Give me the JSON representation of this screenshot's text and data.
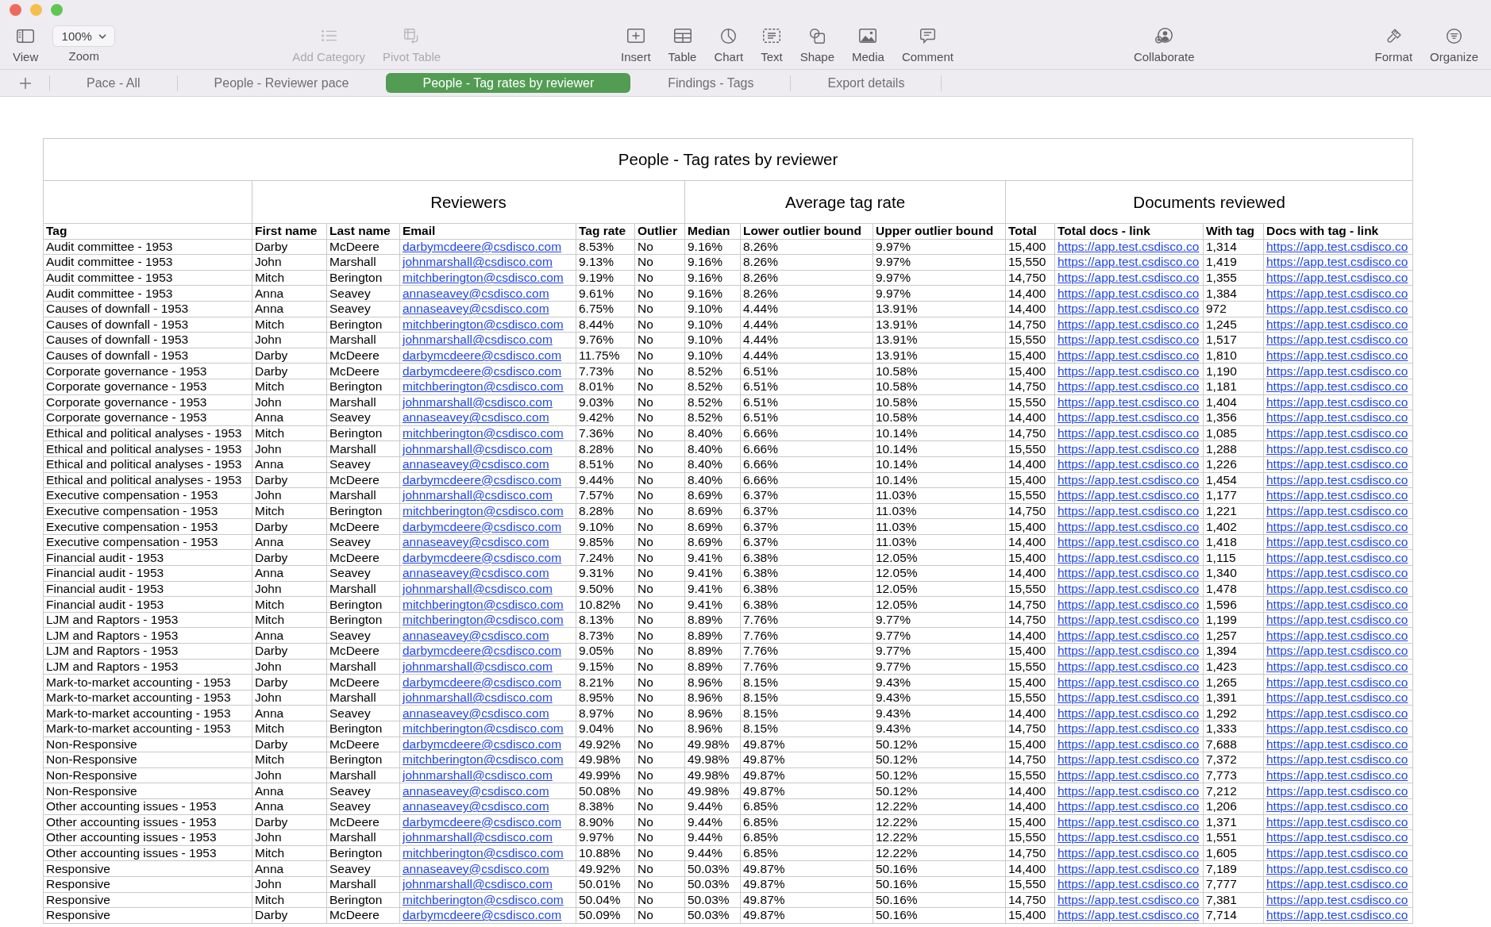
{
  "toolbar": {
    "groups": [
      [
        {
          "kind": "button",
          "label": "View",
          "disabled": false
        },
        {
          "kind": "dropdown",
          "label": "Zoom",
          "value": "100%",
          "disabled": false
        }
      ],
      [
        {
          "kind": "button",
          "label": "Add Category",
          "disabled": true
        },
        {
          "kind": "button",
          "label": "Pivot Table",
          "disabled": true
        }
      ],
      [
        {
          "kind": "button",
          "label": "Insert",
          "disabled": false
        },
        {
          "kind": "button",
          "label": "Table",
          "disabled": false
        },
        {
          "kind": "button",
          "label": "Chart",
          "disabled": false
        },
        {
          "kind": "button",
          "label": "Text",
          "disabled": false
        },
        {
          "kind": "button",
          "label": "Shape",
          "disabled": false
        },
        {
          "kind": "button",
          "label": "Media",
          "disabled": false
        },
        {
          "kind": "button",
          "label": "Comment",
          "disabled": false
        }
      ],
      [
        {
          "kind": "button",
          "label": "Collaborate",
          "disabled": false
        }
      ],
      [
        {
          "kind": "button",
          "label": "Format",
          "disabled": false
        },
        {
          "kind": "button",
          "label": "Organize",
          "disabled": false
        }
      ]
    ]
  },
  "sheet_tabs": [
    {
      "label": "Pace - All",
      "selected": false
    },
    {
      "label": "People - Reviewer pace",
      "selected": false
    },
    {
      "label": "People - Tag rates by reviewer",
      "selected": true
    },
    {
      "label": "Findings - Tags",
      "selected": false
    },
    {
      "label": "Export details",
      "selected": false
    }
  ],
  "table": {
    "title": "People - Tag rates by reviewer",
    "column_groups": [
      {
        "columns": [
          {
            "label": "Tag",
            "kind": "text"
          }
        ]
      },
      {
        "label": "Reviewers",
        "columns": [
          {
            "label": "First name",
            "kind": "text"
          },
          {
            "label": "Last name",
            "kind": "text"
          },
          {
            "label": "Email",
            "kind": "email"
          },
          {
            "label": "Tag rate",
            "kind": "text"
          },
          {
            "label": "Outlier",
            "kind": "text"
          }
        ]
      },
      {
        "label": "Average tag rate",
        "columns": [
          {
            "label": "Median",
            "kind": "text"
          },
          {
            "label": "Lower outlier bound",
            "kind": "text"
          },
          {
            "label": "Upper outlier bound",
            "kind": "text"
          }
        ]
      },
      {
        "label": "Documents reviewed",
        "columns": [
          {
            "label": "Total",
            "kind": "text"
          },
          {
            "label": "Total docs - link",
            "kind": "url"
          },
          {
            "label": "With tag",
            "kind": "text"
          },
          {
            "label": "Docs with tag - link",
            "kind": "url"
          }
        ]
      }
    ],
    "rows": [
      [
        "Audit committee - 1953",
        "Darby",
        "McDeere",
        "darbymcdeere@csdisco.com",
        "8.53%",
        "No",
        "9.16%",
        "8.26%",
        "9.97%",
        "15,400",
        "https://app.test.csdisco.co",
        "1,314",
        "https://app.test.csdisco.co"
      ],
      [
        "Audit committee - 1953",
        "John",
        "Marshall",
        "johnmarshall@csdisco.com",
        "9.13%",
        "No",
        "9.16%",
        "8.26%",
        "9.97%",
        "15,550",
        "https://app.test.csdisco.co",
        "1,419",
        "https://app.test.csdisco.co"
      ],
      [
        "Audit committee - 1953",
        "Mitch",
        "Berington",
        "mitchberington@csdisco.com",
        "9.19%",
        "No",
        "9.16%",
        "8.26%",
        "9.97%",
        "14,750",
        "https://app.test.csdisco.co",
        "1,355",
        "https://app.test.csdisco.co"
      ],
      [
        "Audit committee - 1953",
        "Anna",
        "Seavey",
        "annaseavey@csdisco.com",
        "9.61%",
        "No",
        "9.16%",
        "8.26%",
        "9.97%",
        "14,400",
        "https://app.test.csdisco.co",
        "1,384",
        "https://app.test.csdisco.co"
      ],
      [
        "Causes of downfall - 1953",
        "Anna",
        "Seavey",
        "annaseavey@csdisco.com",
        "6.75%",
        "No",
        "9.10%",
        "4.44%",
        "13.91%",
        "14,400",
        "https://app.test.csdisco.co",
        "972",
        "https://app.test.csdisco.co"
      ],
      [
        "Causes of downfall - 1953",
        "Mitch",
        "Berington",
        "mitchberington@csdisco.com",
        "8.44%",
        "No",
        "9.10%",
        "4.44%",
        "13.91%",
        "14,750",
        "https://app.test.csdisco.co",
        "1,245",
        "https://app.test.csdisco.co"
      ],
      [
        "Causes of downfall - 1953",
        "John",
        "Marshall",
        "johnmarshall@csdisco.com",
        "9.76%",
        "No",
        "9.10%",
        "4.44%",
        "13.91%",
        "15,550",
        "https://app.test.csdisco.co",
        "1,517",
        "https://app.test.csdisco.co"
      ],
      [
        "Causes of downfall - 1953",
        "Darby",
        "McDeere",
        "darbymcdeere@csdisco.com",
        "11.75%",
        "No",
        "9.10%",
        "4.44%",
        "13.91%",
        "15,400",
        "https://app.test.csdisco.co",
        "1,810",
        "https://app.test.csdisco.co"
      ],
      [
        "Corporate governance - 1953",
        "Darby",
        "McDeere",
        "darbymcdeere@csdisco.com",
        "7.73%",
        "No",
        "8.52%",
        "6.51%",
        "10.58%",
        "15,400",
        "https://app.test.csdisco.co",
        "1,190",
        "https://app.test.csdisco.co"
      ],
      [
        "Corporate governance - 1953",
        "Mitch",
        "Berington",
        "mitchberington@csdisco.com",
        "8.01%",
        "No",
        "8.52%",
        "6.51%",
        "10.58%",
        "14,750",
        "https://app.test.csdisco.co",
        "1,181",
        "https://app.test.csdisco.co"
      ],
      [
        "Corporate governance - 1953",
        "John",
        "Marshall",
        "johnmarshall@csdisco.com",
        "9.03%",
        "No",
        "8.52%",
        "6.51%",
        "10.58%",
        "15,550",
        "https://app.test.csdisco.co",
        "1,404",
        "https://app.test.csdisco.co"
      ],
      [
        "Corporate governance - 1953",
        "Anna",
        "Seavey",
        "annaseavey@csdisco.com",
        "9.42%",
        "No",
        "8.52%",
        "6.51%",
        "10.58%",
        "14,400",
        "https://app.test.csdisco.co",
        "1,356",
        "https://app.test.csdisco.co"
      ],
      [
        "Ethical and political analyses - 1953",
        "Mitch",
        "Berington",
        "mitchberington@csdisco.com",
        "7.36%",
        "No",
        "8.40%",
        "6.66%",
        "10.14%",
        "14,750",
        "https://app.test.csdisco.co",
        "1,085",
        "https://app.test.csdisco.co"
      ],
      [
        "Ethical and political analyses - 1953",
        "John",
        "Marshall",
        "johnmarshall@csdisco.com",
        "8.28%",
        "No",
        "8.40%",
        "6.66%",
        "10.14%",
        "15,550",
        "https://app.test.csdisco.co",
        "1,288",
        "https://app.test.csdisco.co"
      ],
      [
        "Ethical and political analyses - 1953",
        "Anna",
        "Seavey",
        "annaseavey@csdisco.com",
        "8.51%",
        "No",
        "8.40%",
        "6.66%",
        "10.14%",
        "14,400",
        "https://app.test.csdisco.co",
        "1,226",
        "https://app.test.csdisco.co"
      ],
      [
        "Ethical and political analyses - 1953",
        "Darby",
        "McDeere",
        "darbymcdeere@csdisco.com",
        "9.44%",
        "No",
        "8.40%",
        "6.66%",
        "10.14%",
        "15,400",
        "https://app.test.csdisco.co",
        "1,454",
        "https://app.test.csdisco.co"
      ],
      [
        "Executive compensation - 1953",
        "John",
        "Marshall",
        "johnmarshall@csdisco.com",
        "7.57%",
        "No",
        "8.69%",
        "6.37%",
        "11.03%",
        "15,550",
        "https://app.test.csdisco.co",
        "1,177",
        "https://app.test.csdisco.co"
      ],
      [
        "Executive compensation - 1953",
        "Mitch",
        "Berington",
        "mitchberington@csdisco.com",
        "8.28%",
        "No",
        "8.69%",
        "6.37%",
        "11.03%",
        "14,750",
        "https://app.test.csdisco.co",
        "1,221",
        "https://app.test.csdisco.co"
      ],
      [
        "Executive compensation - 1953",
        "Darby",
        "McDeere",
        "darbymcdeere@csdisco.com",
        "9.10%",
        "No",
        "8.69%",
        "6.37%",
        "11.03%",
        "15,400",
        "https://app.test.csdisco.co",
        "1,402",
        "https://app.test.csdisco.co"
      ],
      [
        "Executive compensation - 1953",
        "Anna",
        "Seavey",
        "annaseavey@csdisco.com",
        "9.85%",
        "No",
        "8.69%",
        "6.37%",
        "11.03%",
        "14,400",
        "https://app.test.csdisco.co",
        "1,418",
        "https://app.test.csdisco.co"
      ],
      [
        "Financial audit - 1953",
        "Darby",
        "McDeere",
        "darbymcdeere@csdisco.com",
        "7.24%",
        "No",
        "9.41%",
        "6.38%",
        "12.05%",
        "15,400",
        "https://app.test.csdisco.co",
        "1,115",
        "https://app.test.csdisco.co"
      ],
      [
        "Financial audit - 1953",
        "Anna",
        "Seavey",
        "annaseavey@csdisco.com",
        "9.31%",
        "No",
        "9.41%",
        "6.38%",
        "12.05%",
        "14,400",
        "https://app.test.csdisco.co",
        "1,340",
        "https://app.test.csdisco.co"
      ],
      [
        "Financial audit - 1953",
        "John",
        "Marshall",
        "johnmarshall@csdisco.com",
        "9.50%",
        "No",
        "9.41%",
        "6.38%",
        "12.05%",
        "15,550",
        "https://app.test.csdisco.co",
        "1,478",
        "https://app.test.csdisco.co"
      ],
      [
        "Financial audit - 1953",
        "Mitch",
        "Berington",
        "mitchberington@csdisco.com",
        "10.82%",
        "No",
        "9.41%",
        "6.38%",
        "12.05%",
        "14,750",
        "https://app.test.csdisco.co",
        "1,596",
        "https://app.test.csdisco.co"
      ],
      [
        "LJM and Raptors - 1953",
        "Mitch",
        "Berington",
        "mitchberington@csdisco.com",
        "8.13%",
        "No",
        "8.89%",
        "7.76%",
        "9.77%",
        "14,750",
        "https://app.test.csdisco.co",
        "1,199",
        "https://app.test.csdisco.co"
      ],
      [
        "LJM and Raptors - 1953",
        "Anna",
        "Seavey",
        "annaseavey@csdisco.com",
        "8.73%",
        "No",
        "8.89%",
        "7.76%",
        "9.77%",
        "14,400",
        "https://app.test.csdisco.co",
        "1,257",
        "https://app.test.csdisco.co"
      ],
      [
        "LJM and Raptors - 1953",
        "Darby",
        "McDeere",
        "darbymcdeere@csdisco.com",
        "9.05%",
        "No",
        "8.89%",
        "7.76%",
        "9.77%",
        "15,400",
        "https://app.test.csdisco.co",
        "1,394",
        "https://app.test.csdisco.co"
      ],
      [
        "LJM and Raptors - 1953",
        "John",
        "Marshall",
        "johnmarshall@csdisco.com",
        "9.15%",
        "No",
        "8.89%",
        "7.76%",
        "9.77%",
        "15,550",
        "https://app.test.csdisco.co",
        "1,423",
        "https://app.test.csdisco.co"
      ],
      [
        "Mark-to-market accounting - 1953",
        "Darby",
        "McDeere",
        "darbymcdeere@csdisco.com",
        "8.21%",
        "No",
        "8.96%",
        "8.15%",
        "9.43%",
        "15,400",
        "https://app.test.csdisco.co",
        "1,265",
        "https://app.test.csdisco.co"
      ],
      [
        "Mark-to-market accounting - 1953",
        "John",
        "Marshall",
        "johnmarshall@csdisco.com",
        "8.95%",
        "No",
        "8.96%",
        "8.15%",
        "9.43%",
        "15,550",
        "https://app.test.csdisco.co",
        "1,391",
        "https://app.test.csdisco.co"
      ],
      [
        "Mark-to-market accounting - 1953",
        "Anna",
        "Seavey",
        "annaseavey@csdisco.com",
        "8.97%",
        "No",
        "8.96%",
        "8.15%",
        "9.43%",
        "14,400",
        "https://app.test.csdisco.co",
        "1,292",
        "https://app.test.csdisco.co"
      ],
      [
        "Mark-to-market accounting - 1953",
        "Mitch",
        "Berington",
        "mitchberington@csdisco.com",
        "9.04%",
        "No",
        "8.96%",
        "8.15%",
        "9.43%",
        "14,750",
        "https://app.test.csdisco.co",
        "1,333",
        "https://app.test.csdisco.co"
      ],
      [
        "Non-Responsive",
        "Darby",
        "McDeere",
        "darbymcdeere@csdisco.com",
        "49.92%",
        "No",
        "49.98%",
        "49.87%",
        "50.12%",
        "15,400",
        "https://app.test.csdisco.co",
        "7,688",
        "https://app.test.csdisco.co"
      ],
      [
        "Non-Responsive",
        "Mitch",
        "Berington",
        "mitchberington@csdisco.com",
        "49.98%",
        "No",
        "49.98%",
        "49.87%",
        "50.12%",
        "14,750",
        "https://app.test.csdisco.co",
        "7,372",
        "https://app.test.csdisco.co"
      ],
      [
        "Non-Responsive",
        "John",
        "Marshall",
        "johnmarshall@csdisco.com",
        "49.99%",
        "No",
        "49.98%",
        "49.87%",
        "50.12%",
        "15,550",
        "https://app.test.csdisco.co",
        "7,773",
        "https://app.test.csdisco.co"
      ],
      [
        "Non-Responsive",
        "Anna",
        "Seavey",
        "annaseavey@csdisco.com",
        "50.08%",
        "No",
        "49.98%",
        "49.87%",
        "50.12%",
        "14,400",
        "https://app.test.csdisco.co",
        "7,212",
        "https://app.test.csdisco.co"
      ],
      [
        "Other accounting issues - 1953",
        "Anna",
        "Seavey",
        "annaseavey@csdisco.com",
        "8.38%",
        "No",
        "9.44%",
        "6.85%",
        "12.22%",
        "14,400",
        "https://app.test.csdisco.co",
        "1,206",
        "https://app.test.csdisco.co"
      ],
      [
        "Other accounting issues - 1953",
        "Darby",
        "McDeere",
        "darbymcdeere@csdisco.com",
        "8.90%",
        "No",
        "9.44%",
        "6.85%",
        "12.22%",
        "15,400",
        "https://app.test.csdisco.co",
        "1,371",
        "https://app.test.csdisco.co"
      ],
      [
        "Other accounting issues - 1953",
        "John",
        "Marshall",
        "johnmarshall@csdisco.com",
        "9.97%",
        "No",
        "9.44%",
        "6.85%",
        "12.22%",
        "15,550",
        "https://app.test.csdisco.co",
        "1,551",
        "https://app.test.csdisco.co"
      ],
      [
        "Other accounting issues - 1953",
        "Mitch",
        "Berington",
        "mitchberington@csdisco.com",
        "10.88%",
        "No",
        "9.44%",
        "6.85%",
        "12.22%",
        "14,750",
        "https://app.test.csdisco.co",
        "1,605",
        "https://app.test.csdisco.co"
      ],
      [
        "Responsive",
        "Anna",
        "Seavey",
        "annaseavey@csdisco.com",
        "49.92%",
        "No",
        "50.03%",
        "49.87%",
        "50.16%",
        "14,400",
        "https://app.test.csdisco.co",
        "7,189",
        "https://app.test.csdisco.co"
      ],
      [
        "Responsive",
        "John",
        "Marshall",
        "johnmarshall@csdisco.com",
        "50.01%",
        "No",
        "50.03%",
        "49.87%",
        "50.16%",
        "15,550",
        "https://app.test.csdisco.co",
        "7,777",
        "https://app.test.csdisco.co"
      ],
      [
        "Responsive",
        "Mitch",
        "Berington",
        "mitchberington@csdisco.com",
        "50.04%",
        "No",
        "50.03%",
        "49.87%",
        "50.16%",
        "14,750",
        "https://app.test.csdisco.co",
        "7,381",
        "https://app.test.csdisco.co"
      ],
      [
        "Responsive",
        "Darby",
        "McDeere",
        "darbymcdeere@csdisco.com",
        "50.09%",
        "No",
        "50.03%",
        "49.87%",
        "50.16%",
        "15,400",
        "https://app.test.csdisco.co",
        "7,714",
        "https://app.test.csdisco.co"
      ]
    ]
  }
}
